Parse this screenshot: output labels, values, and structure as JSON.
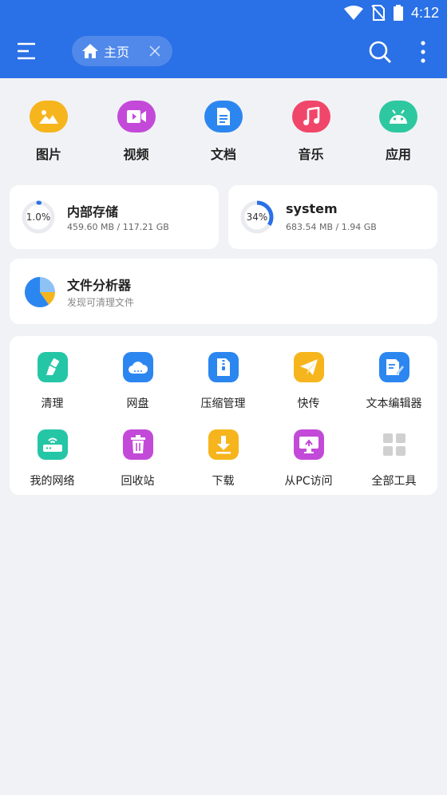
{
  "status_bar": {
    "time": "4:12",
    "icons": [
      "wifi-icon",
      "no-sim-icon",
      "battery-icon"
    ]
  },
  "app_bar": {
    "tab": {
      "label": "主页",
      "icon": "home-icon"
    },
    "accent": "#2a70e6"
  },
  "categories": [
    {
      "label": "图片",
      "icon": "image-icon",
      "color": "#f6b51c"
    },
    {
      "label": "视频",
      "icon": "video-icon",
      "color": "#c34ad8"
    },
    {
      "label": "文档",
      "icon": "document-icon",
      "color": "#2c86f0"
    },
    {
      "label": "音乐",
      "icon": "music-icon",
      "color": "#f0466a"
    },
    {
      "label": "应用",
      "icon": "android-icon",
      "color": "#2ec8a0"
    }
  ],
  "storage": [
    {
      "title": "内部存储",
      "percent_text": "1.0%",
      "percent": 1.0,
      "detail": "459.60 MB / 117.21 GB"
    },
    {
      "title": "system",
      "percent_text": "34%",
      "percent": 34,
      "detail": "683.54 MB / 1.94 GB"
    }
  ],
  "analyzer": {
    "title": "文件分析器",
    "subtitle": "发现可清理文件"
  },
  "tools": [
    {
      "label": "清理",
      "icon": "broom-icon",
      "color": "#24c6a6"
    },
    {
      "label": "网盘",
      "icon": "cloud-icon",
      "color": "#2c86f0"
    },
    {
      "label": "压缩管理",
      "icon": "zip-icon",
      "color": "#2c86f0"
    },
    {
      "label": "快传",
      "icon": "send-icon",
      "color": "#f6b51c"
    },
    {
      "label": "文本编辑器",
      "icon": "edit-icon",
      "color": "#2c86f0"
    },
    {
      "label": "我的网络",
      "icon": "router-icon",
      "color": "#24c6a6"
    },
    {
      "label": "回收站",
      "icon": "trash-icon",
      "color": "#c34ad8"
    },
    {
      "label": "下载",
      "icon": "download-icon",
      "color": "#f6b51c"
    },
    {
      "label": "从PC访问",
      "icon": "pc-icon",
      "color": "#c34ad8"
    },
    {
      "label": "全部工具",
      "icon": "grid-icon",
      "color": "#cfcfcf"
    }
  ]
}
